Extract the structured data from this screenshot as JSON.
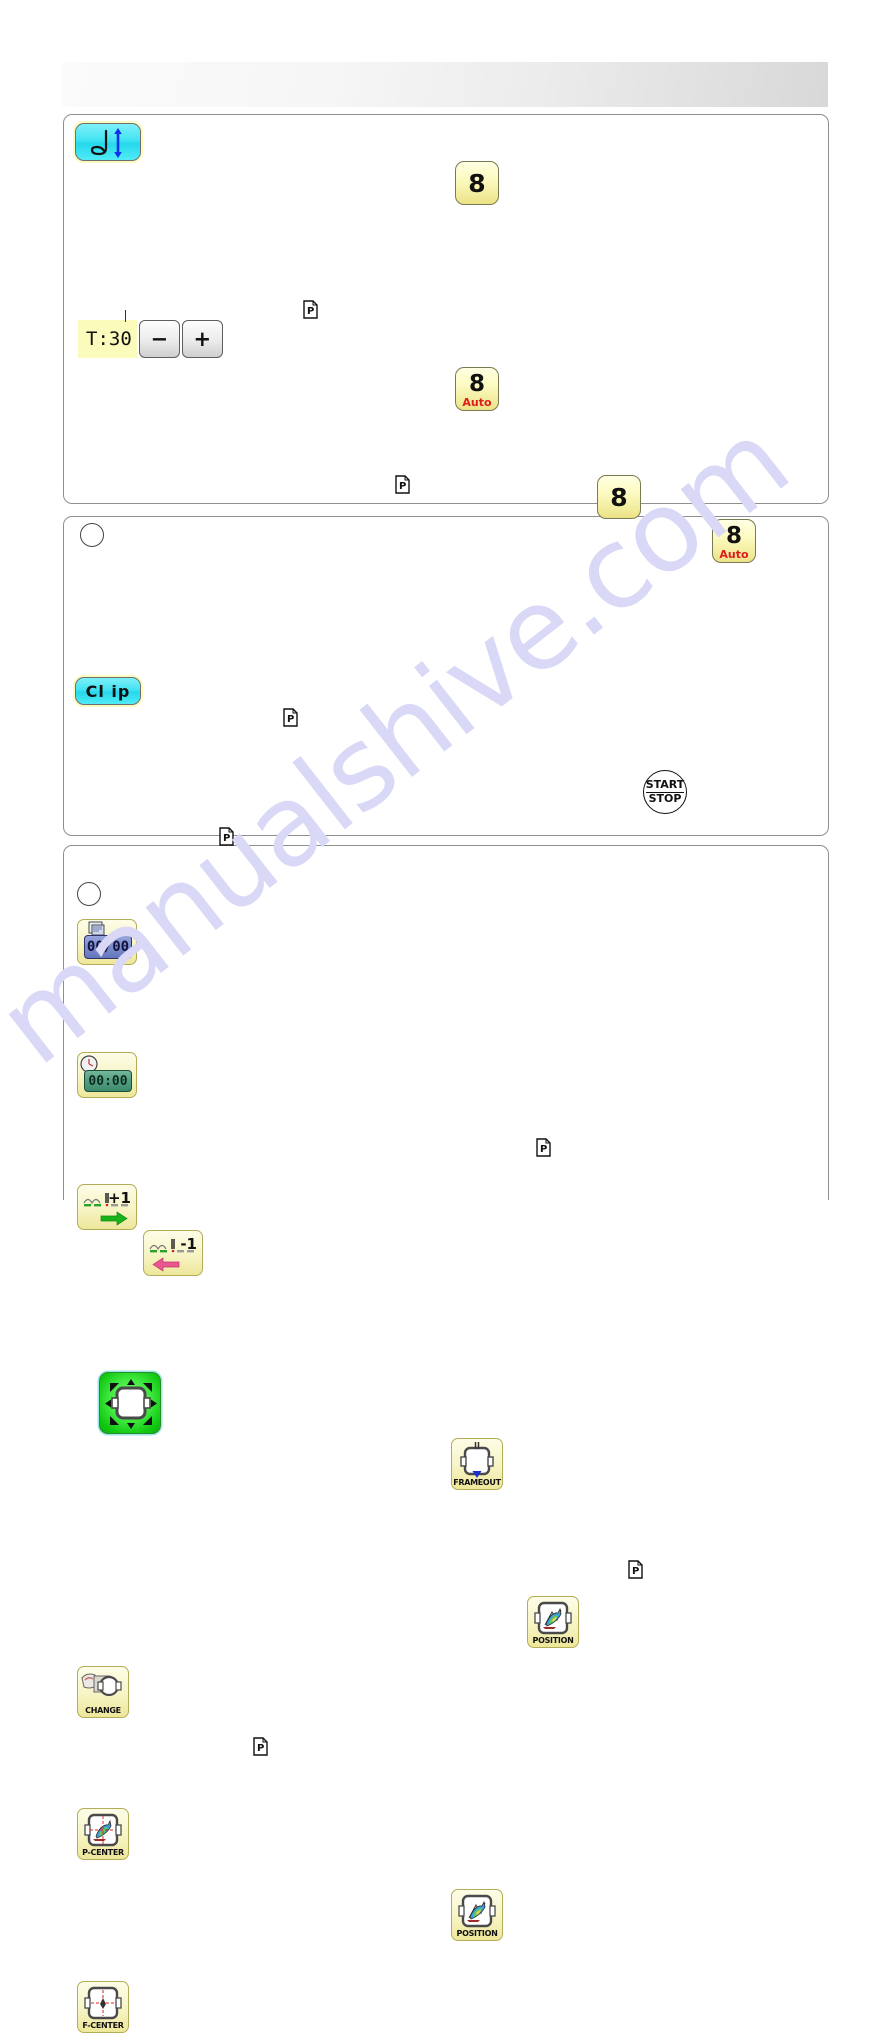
{
  "document": {
    "watermark": "manualshive.com",
    "header_title": ""
  },
  "panels": [
    {
      "id": "panel-thread-trim",
      "name": "thread-and-tension-panel",
      "keys": {
        "thread_trim": {
          "icon": "thread-trim-icon",
          "label": ""
        },
        "needle_number": {
          "value": "8",
          "auto_label": ""
        },
        "needle_number_auto": {
          "value": "8",
          "auto_label": "Auto"
        },
        "needle_number_2": {
          "value": "8",
          "auto_label": ""
        },
        "needle_number_auto_2": {
          "value": "8",
          "auto_label": "Auto"
        },
        "tension": {
          "display": "T:30",
          "decrease_label": "−",
          "increase_label": "+"
        },
        "clip": {
          "label": "Cl ip"
        }
      },
      "page_refs": [
        "P",
        "P",
        "P"
      ]
    },
    {
      "id": "panel-counter",
      "name": "counter-and-run-panel",
      "bullet": "○",
      "keys": {
        "counter": {
          "display": "00/00",
          "icon": "stitch-counter-icon"
        },
        "timer": {
          "display": "00:00",
          "icon": "clock-icon"
        },
        "stitch_forward": {
          "label": "+1",
          "icon": "stitch-forward-icon"
        },
        "stitch_back": {
          "label": "-1",
          "icon": "stitch-back-icon"
        },
        "start_stop": {
          "line1": "START",
          "line2": "STOP"
        }
      },
      "page_refs": [
        "P",
        "P"
      ]
    },
    {
      "id": "panel-frame",
      "name": "frame-movement-panel",
      "bullet": "○",
      "keys": {
        "frame_move": {
          "icon": "frame-move-icon",
          "label": ""
        },
        "frameout": {
          "label": "FRAMEOUT",
          "icon": "frameout-icon"
        },
        "change": {
          "label": "CHANGE",
          "icon": "frame-change-icon"
        },
        "p_center": {
          "label": "P-CENTER",
          "icon": "pattern-center-icon"
        },
        "f_center": {
          "label": "F-CENTER",
          "icon": "frame-center-icon"
        },
        "position_1": {
          "label": "POSITION",
          "icon": "pattern-position-icon"
        },
        "position_2": {
          "label": "POSITION",
          "icon": "pattern-position-icon"
        }
      },
      "page_refs": [
        "P",
        "P"
      ]
    }
  ]
}
